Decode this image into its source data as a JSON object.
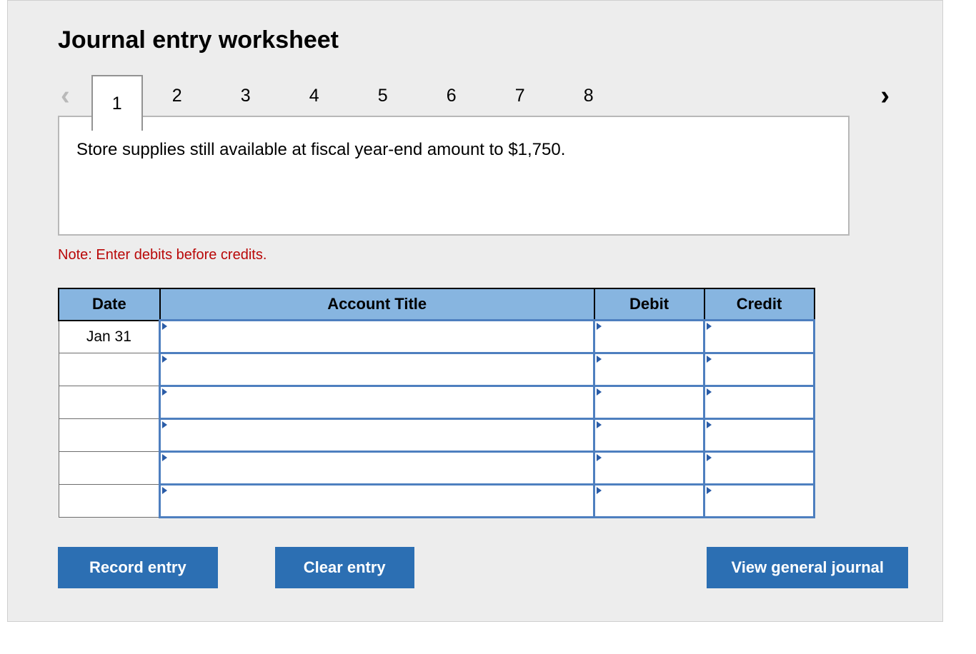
{
  "title": "Journal entry worksheet",
  "steps": [
    "1",
    "2",
    "3",
    "4",
    "5",
    "6",
    "7",
    "8"
  ],
  "active_step": 0,
  "prompt": "Store supplies still available at fiscal year-end amount to $1,750.",
  "note": "Note: Enter debits before credits.",
  "columns": {
    "date": "Date",
    "account": "Account Title",
    "debit": "Debit",
    "credit": "Credit"
  },
  "rows": [
    {
      "date": "Jan 31",
      "account": "",
      "debit": "",
      "credit": ""
    },
    {
      "date": "",
      "account": "",
      "debit": "",
      "credit": ""
    },
    {
      "date": "",
      "account": "",
      "debit": "",
      "credit": ""
    },
    {
      "date": "",
      "account": "",
      "debit": "",
      "credit": ""
    },
    {
      "date": "",
      "account": "",
      "debit": "",
      "credit": ""
    },
    {
      "date": "",
      "account": "",
      "debit": "",
      "credit": ""
    }
  ],
  "buttons": {
    "record": "Record entry",
    "clear": "Clear entry",
    "view": "View general journal"
  }
}
